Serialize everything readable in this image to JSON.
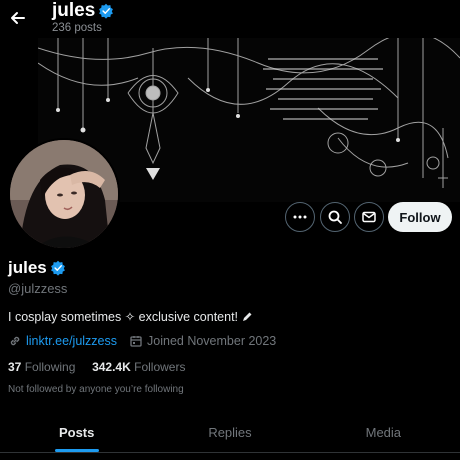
{
  "header": {
    "name": "jules",
    "posts_count": "236 posts"
  },
  "profile": {
    "name": "jules",
    "handle": "@julzzess",
    "bio": "I cosplay sometimes ✧ exclusive content!",
    "link": "linktr.ee/julzzess",
    "joined": "Joined November 2023",
    "following_count": "37",
    "following_label": "Following",
    "followers_count": "342.4K",
    "followers_label": "Followers",
    "not_followed_text": "Not followed by anyone you’re following"
  },
  "actions": {
    "follow_label": "Follow"
  },
  "tabs": [
    {
      "label": "Posts",
      "active": true
    },
    {
      "label": "Replies",
      "active": false
    },
    {
      "label": "Media",
      "active": false
    }
  ],
  "colors": {
    "accent": "#1d9bf0",
    "background": "#000000",
    "verified": "#1d9bf0"
  }
}
